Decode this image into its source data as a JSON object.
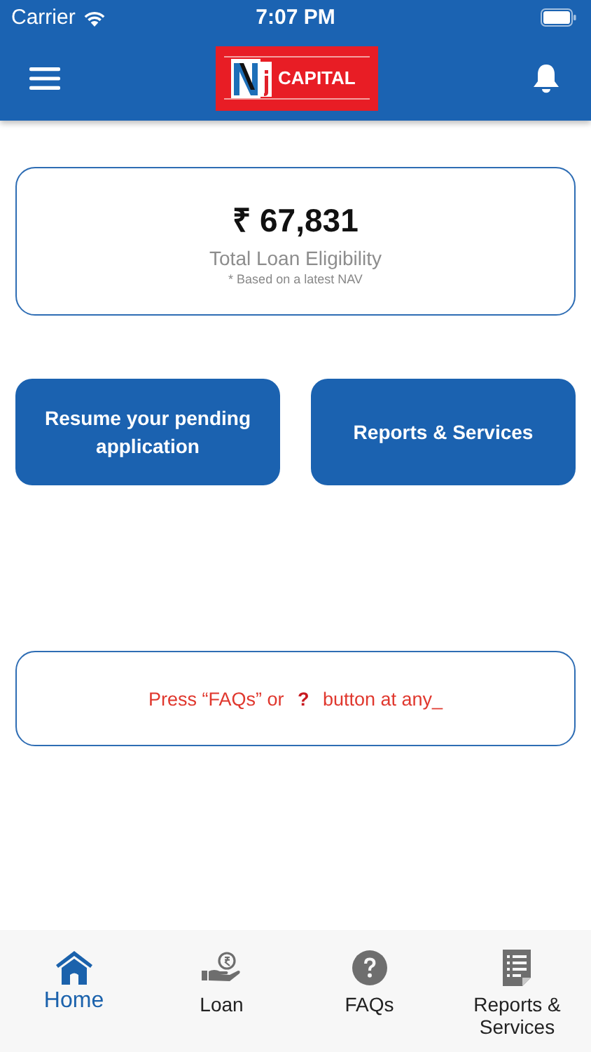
{
  "status_bar": {
    "carrier": "Carrier",
    "time": "7:07 PM"
  },
  "header": {
    "logo_text": "CAPITAL"
  },
  "eligibility": {
    "amount": "₹ 67,831",
    "label": "Total Loan Eligibility",
    "note": "* Based on a latest NAV"
  },
  "actions": [
    "Resume your pending application",
    "Reports & Services"
  ],
  "notice": "Press “FAQs” or **?** button at any_",
  "tabs": [
    {
      "kind": "home",
      "label": "Home",
      "selected": true
    },
    {
      "kind": "loan",
      "label": "Loan",
      "selected": false
    },
    {
      "kind": "faq",
      "label": "FAQs",
      "selected": false
    },
    {
      "kind": "reports",
      "label": "Reports &\nServices",
      "selected": false
    }
  ]
}
